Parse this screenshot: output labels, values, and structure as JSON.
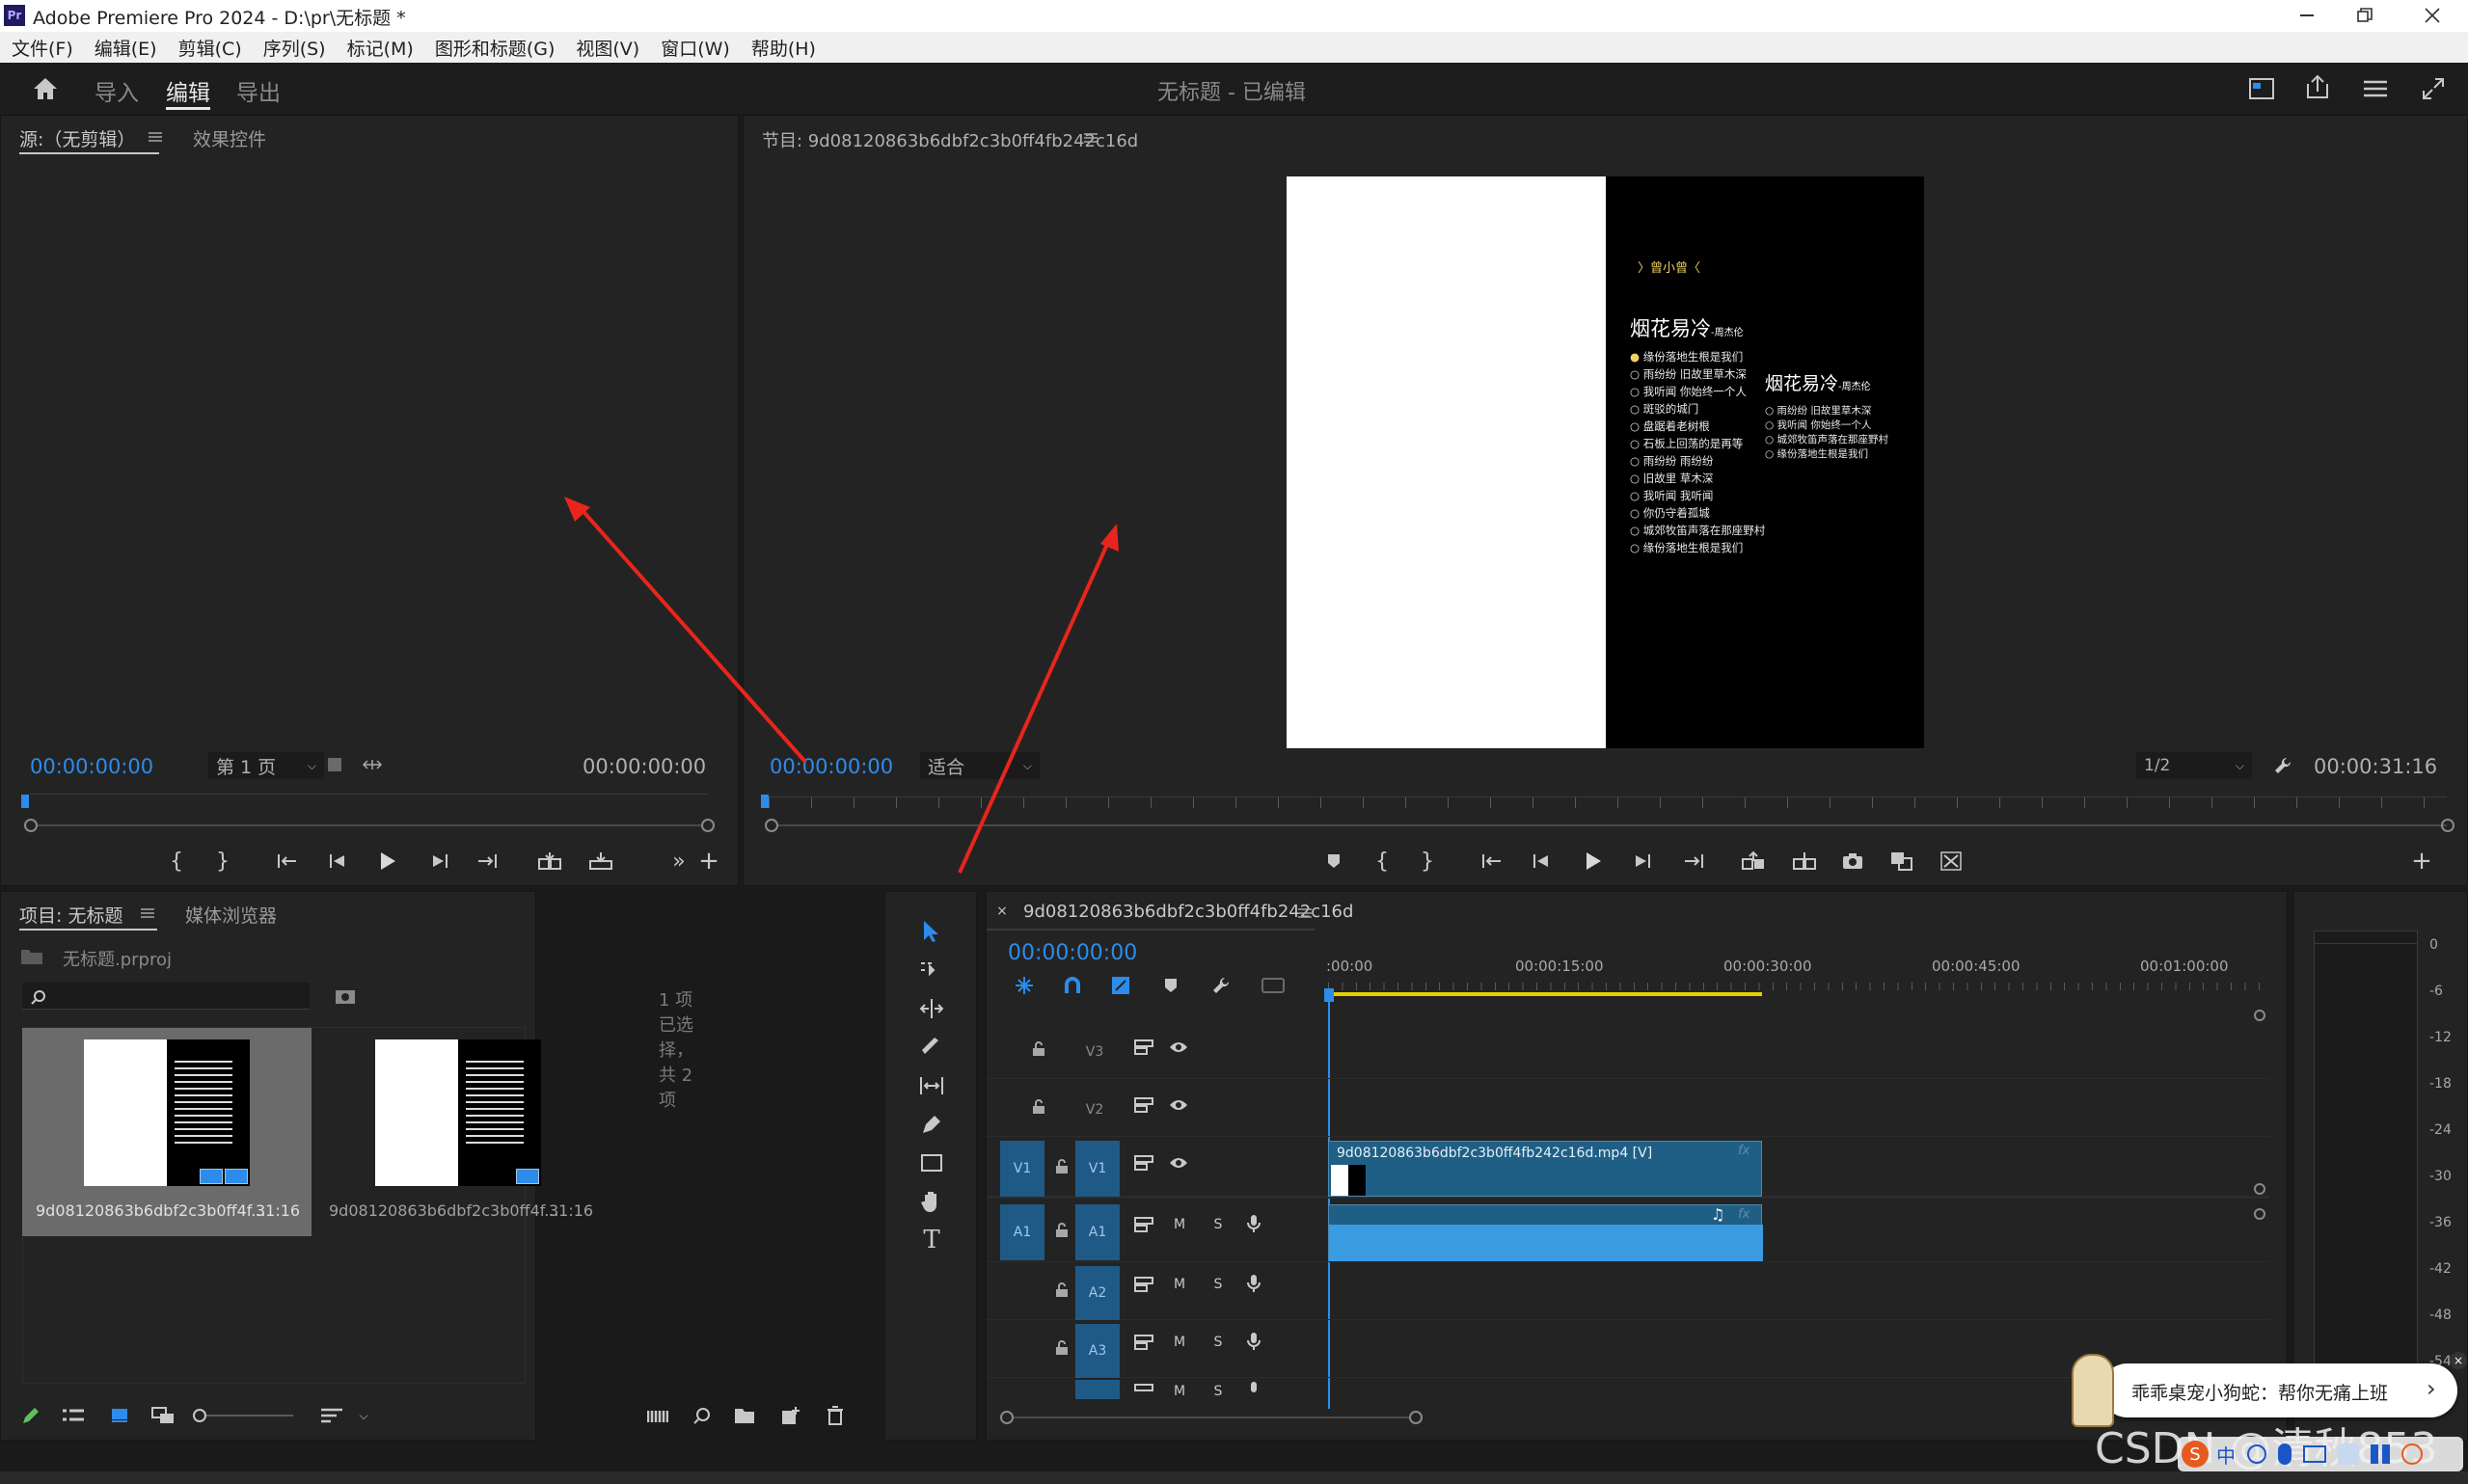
{
  "window": {
    "app_title": "Adobe Premiere Pro 2024 - D:\\pr\\无标题 *",
    "logo": "Pr"
  },
  "menu": [
    "文件(F)",
    "编辑(E)",
    "剪辑(C)",
    "序列(S)",
    "标记(M)",
    "图形和标题(G)",
    "视图(V)",
    "窗口(W)",
    "帮助(H)"
  ],
  "workspace": {
    "tabs": [
      "导入",
      "编辑",
      "导出"
    ],
    "active": "编辑",
    "doc_title": "无标题 - 已编辑"
  },
  "source_panel": {
    "tabs": [
      "源:（无剪辑）",
      "效果控件"
    ],
    "timecode_left": "00:00:00:00",
    "page_select": "第 1 页",
    "timecode_right": "00:00:00:00"
  },
  "program_panel": {
    "title": "节目: 9d08120863b6dbf2c3b0ff4fb242c16d",
    "timecode_left": "00:00:00:00",
    "fit_select": "适合",
    "quality_select": "1/2",
    "timecode_right": "00:00:31:16"
  },
  "video_frame": {
    "artist_line": "〉曾小曾〈",
    "song_title": "烟花易冷",
    "song_artist": "-周杰伦",
    "lyrics_left": [
      "缘份落地生根是我们",
      "雨纷纷 旧故里草木深",
      "我听闻 你始终一个人",
      "斑驳的城门",
      "盘踞着老树根",
      "石板上回荡的是再等",
      "雨纷纷 雨纷纷",
      "旧故里 草木深",
      "我听闻 我听闻",
      "你仍守着孤城",
      "城郊牧笛声落在那座野村",
      "缘份落地生根是我们"
    ],
    "lyrics_right": [
      "雨纷纷 旧故里草木深",
      "我听闻 你始终一个人",
      "城郊牧笛声落在那座野村",
      "缘份落地生根是我们"
    ]
  },
  "project_panel": {
    "tabs": [
      "项目: 无标题",
      "媒体浏览器"
    ],
    "project_file": "无标题.prproj",
    "selection_info": "1 项已选择，共 2 项",
    "items": [
      {
        "name": "9d08120863b6dbf2c3b0ff4f...",
        "duration": "31:16"
      },
      {
        "name": "9d08120863b6dbf2c3b0ff4f...",
        "duration": "31:16"
      }
    ]
  },
  "timeline": {
    "tab": "9d08120863b6dbf2c3b0ff4fb242c16d",
    "timecode": "00:00:00:00",
    "ruler": [
      ":00:00",
      "00:00:15:00",
      "00:00:30:00",
      "00:00:45:00",
      "00:01:00:00"
    ],
    "tracks": [
      {
        "name": "V3"
      },
      {
        "name": "V2"
      },
      {
        "name": "V1",
        "src": "V1"
      },
      {
        "name": "A1",
        "src": "A1"
      },
      {
        "name": "A2"
      },
      {
        "name": "A3"
      }
    ],
    "video_clip": "9d08120863b6dbf2c3b0ff4fb242c16d.mp4 [V]",
    "fx": "fx",
    "mute": "M",
    "solo": "S"
  },
  "meter": {
    "labels": [
      "0",
      "-6",
      "-12",
      "-18",
      "-24",
      "-30",
      "-36",
      "-42",
      "-48",
      "-54"
    ]
  },
  "notification": {
    "text": "乖乖桌宠小狗蛇：帮你无痛上班",
    "arrow": "›"
  },
  "watermark": "CSDN @清秋853",
  "ime": {
    "lang": "中"
  },
  "colors": {
    "accent_blue": "#2d8ceb",
    "clip_video": "#1f5f86",
    "clip_audio": "#3a9be0",
    "annotation_arrow": "#e8251c"
  }
}
